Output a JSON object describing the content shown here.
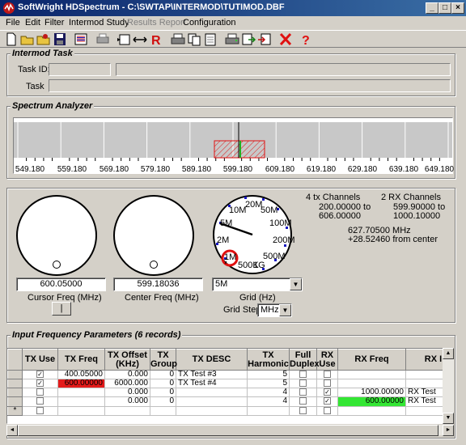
{
  "window": {
    "title": "SoftWright HDSpectrum - C:\\SWTAP\\INTERMOD\\TUTIMOD.DBF"
  },
  "menu": [
    {
      "label": "File",
      "enabled": true
    },
    {
      "label": "Edit",
      "enabled": true
    },
    {
      "label": "Filter",
      "enabled": true
    },
    {
      "label": "Intermod Study",
      "enabled": true
    },
    {
      "label": "Results Report",
      "enabled": false
    },
    {
      "label": "Configuration",
      "enabled": true
    }
  ],
  "toolbar_icons": [
    "new-icon",
    "open-icon",
    "open-db-icon",
    "save-icon",
    "list-icon",
    "print-setup-icon",
    "insert-icon",
    "span-icon",
    "r-icon",
    "print-icon",
    "copy-icon",
    "paste-icon",
    "print2-icon",
    "export-icon",
    "import-icon",
    "delete-icon",
    "help-icon"
  ],
  "intermod_task": {
    "title": "Intermod Task",
    "task_id_label": "Task ID:",
    "task_label": "Task",
    "task_id_value": "",
    "task_id_desc": "",
    "task_value": ""
  },
  "spectrum": {
    "title": "Spectrum Analyzer",
    "ticks": [
      "549.180",
      "559.180",
      "569.180",
      "579.180",
      "589.180",
      "599.180",
      "609.180",
      "619.180",
      "629.180",
      "639.180",
      "649.180"
    ]
  },
  "controls": {
    "cursor_freq_value": "600.05000",
    "cursor_freq_label": "Cursor Freq (MHz)",
    "cursor_button": "|",
    "center_freq_value": "599.18036",
    "center_freq_label": "Center Freq (MHz)",
    "grid_label": "Grid (Hz)",
    "grid_value": "5M",
    "grid_step_label": "Grid Step",
    "grid_step_value": "MHz",
    "dial_labels": [
      "5M",
      "10M",
      "20M",
      "50M",
      "100M",
      "200M",
      "500M",
      "1G",
      "500K",
      "1M",
      "2M"
    ]
  },
  "info": {
    "tx_channels": "4 tx Channels",
    "tx_range_1": "200.00000 to",
    "tx_range_2": "606.00000",
    "rx_channels": "2 RX Channels",
    "rx_range_1": "599.90000 to",
    "rx_range_2": "1000.10000",
    "cursor_mhz": "627.70500 MHz",
    "from_center": "+28.52460 from center"
  },
  "input_freq": {
    "title": "Input Frequency Parameters (6 records)",
    "columns": [
      "TX Use",
      "TX Freq",
      "TX Offset (KHz)",
      "TX Group",
      "TX DESC",
      "TX Harmonic",
      "Full Duplex",
      "RX Use",
      "RX Freq",
      "RX I"
    ],
    "rows": [
      {
        "tx_use": true,
        "tx_freq": "400.05000",
        "tx_offset": "0.000",
        "tx_group": "0",
        "tx_desc": "TX Test #3",
        "tx_harm": "5",
        "full_duplex": false,
        "rx_use": false,
        "rx_freq": "",
        "rx_desc": ""
      },
      {
        "tx_use": true,
        "tx_freq": "600.00000",
        "tx_offset": "6000.000",
        "tx_group": "0",
        "tx_desc": "TX Test #4",
        "tx_harm": "5",
        "full_duplex": false,
        "rx_use": false,
        "rx_freq": "",
        "rx_desc": ""
      },
      {
        "tx_use": false,
        "tx_freq": "",
        "tx_offset": "0.000",
        "tx_group": "0",
        "tx_desc": "",
        "tx_harm": "4",
        "full_duplex": false,
        "rx_use": true,
        "rx_freq": "1000.00000",
        "rx_desc": "RX Test"
      },
      {
        "tx_use": false,
        "tx_freq": "",
        "tx_offset": "0.000",
        "tx_group": "0",
        "tx_desc": "",
        "tx_harm": "4",
        "full_duplex": false,
        "rx_use": true,
        "rx_freq": "600.00000",
        "rx_desc": "RX Test"
      },
      {
        "tx_use": false,
        "tx_freq": "",
        "tx_offset": "",
        "tx_group": "",
        "tx_desc": "",
        "tx_harm": "",
        "full_duplex": false,
        "rx_use": false,
        "rx_freq": "",
        "rx_desc": ""
      }
    ],
    "new_row_marker": "*"
  },
  "colors": {
    "title_start": "#0a246a",
    "title_end": "#3a6ea5",
    "highlight_red": "#e41b1b",
    "highlight_green": "#33e633",
    "marker_red": "#e01010"
  }
}
